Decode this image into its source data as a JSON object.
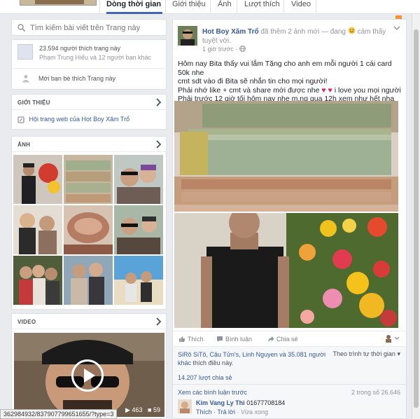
{
  "tabs": [
    {
      "label": "Dòng thời gian",
      "active": true
    },
    {
      "label": "Giới thiệu"
    },
    {
      "label": "Ảnh"
    },
    {
      "label": "Lượt thích"
    },
    {
      "label": "Video"
    }
  ],
  "sidebar": {
    "search_placeholder": "Tìm kiếm bài viết trên Trang này",
    "likes_count": "23.594 người thích trang này",
    "likes_friends": "Phạm Trung Hiếu và 12 người bạn khác",
    "invite": "Mời bạn bè thích Trang này",
    "intro_header": "GIỚI THIỆU",
    "intro_item": "Hội trang web của Hot Boy Xăm Trổ",
    "photos_header": "ẢNH",
    "video_header": "VIDEO",
    "video_views": "463",
    "video_comments": "59"
  },
  "status_url": "362984932/837907799651655/?type=3",
  "post": {
    "author": "Hot Boy Xăm Trổ",
    "action": "đã thêm 2 ảnh mới — đang",
    "feeling": "cảm thấy tuyệt vời.",
    "time": "1 giờ trước",
    "text_lines": [
      "Hôm nay Bita thấy vui lắm Tặng cho anh em mỗi người 1 cái card 50k nhe",
      "cmt sdt vào đi Bita sẽ nhắn tin cho mọi người!",
      "Phải nhớ like + cmt và share mới được nhe",
      "i love you mọi người",
      "Phải trước 12 giờ tối hôm nay nhe m.ng qua 12h xem như hết nha"
    ],
    "like_label": "Thích",
    "comment_label": "Bình luận",
    "share_label": "Chia sẻ",
    "likers": "SiRô SiTô, Cậu Tửn's, Linh Nguyen và 35.081 người khác",
    "likers_suffix": "thích điều này.",
    "sort_label": "Theo trình tự thời gian",
    "shares": "14.207 lượt chia sẻ",
    "view_prev": "Xem các bình luận trước",
    "comment_count": "2 trong số 26.646",
    "commenter": "Kim Vang Ly Thi",
    "comment_text": "01677708184",
    "comment_like": "Thích",
    "comment_reply": "Trả lời",
    "comment_time": "Vừa xong",
    "dot": " · "
  },
  "colors": {
    "link": "#365899",
    "accent": "#4267b2",
    "background": "#e9ebee"
  }
}
